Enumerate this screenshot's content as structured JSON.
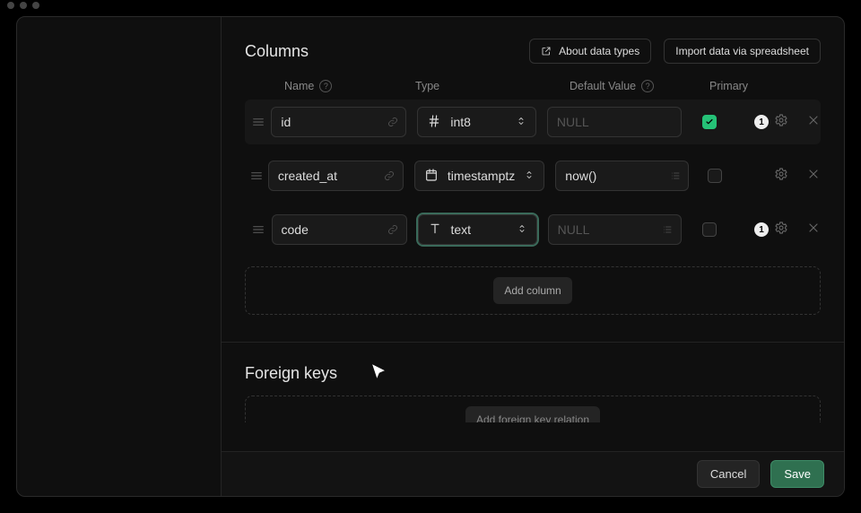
{
  "columnsSection": {
    "title": "Columns",
    "aboutBtn": "About data types",
    "importBtn": "Import data via spreadsheet",
    "headers": {
      "name": "Name",
      "type": "Type",
      "def": "Default Value",
      "prim": "Primary"
    },
    "rows": [
      {
        "name": "id",
        "type": "int8",
        "default": "NULL",
        "defaultEmpty": true,
        "primary": true,
        "badge": "1",
        "showDefOpts": false
      },
      {
        "name": "created_at",
        "type": "timestamptz",
        "default": "now()",
        "defaultEmpty": false,
        "primary": false,
        "badge": null,
        "showDefOpts": true
      },
      {
        "name": "code",
        "type": "text",
        "default": "NULL",
        "defaultEmpty": true,
        "primary": false,
        "badge": "1",
        "showDefOpts": true,
        "focused": true
      }
    ],
    "addBtn": "Add column"
  },
  "fkSection": {
    "title": "Foreign keys",
    "addBtn": "Add foreign key relation"
  },
  "footer": {
    "cancel": "Cancel",
    "save": "Save"
  },
  "icons": {
    "int8": "hash-icon",
    "timestamptz": "calendar-icon",
    "text": "text-type-icon"
  }
}
